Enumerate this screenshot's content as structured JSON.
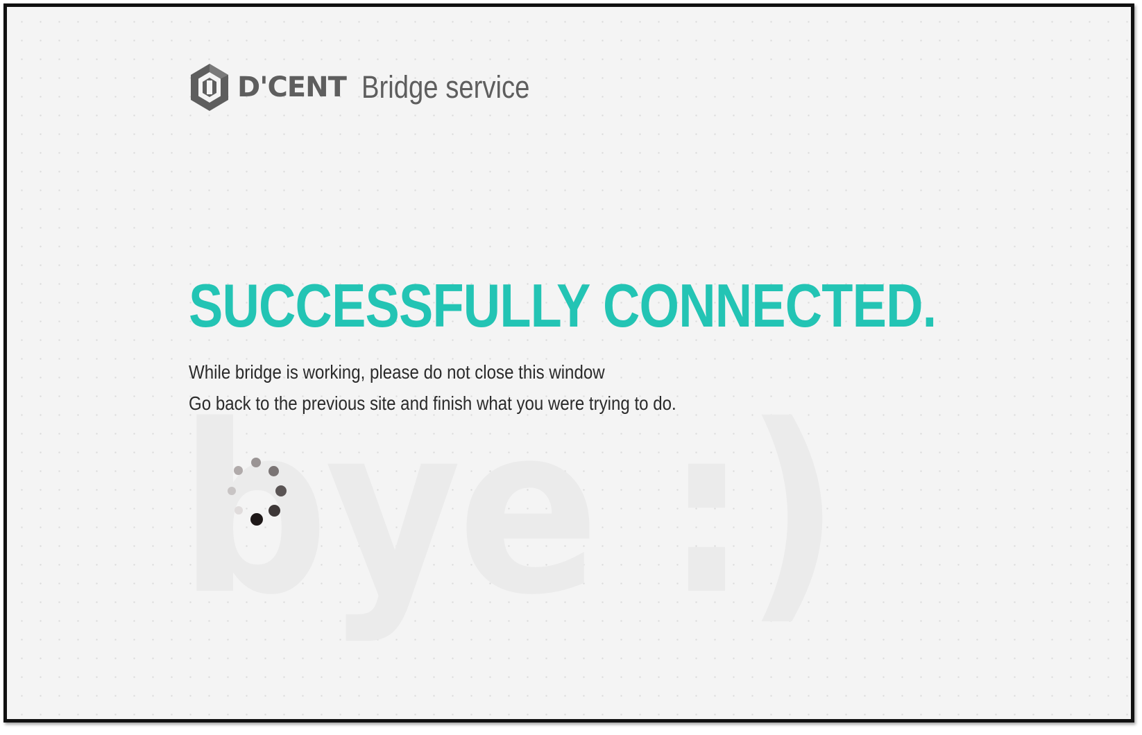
{
  "header": {
    "logo_text": "D'CENT",
    "service_title": "Bridge service"
  },
  "main": {
    "headline": "SUCCESSFULLY CONNECTED.",
    "message_line_1": "While bridge is working, please do not close this window",
    "message_line_2": "Go back to the previous site and finish what you were trying to do.",
    "watermark_text": "bye :)"
  },
  "colors": {
    "accent": "#23c4b4",
    "logo_gray": "#5e5e5e",
    "text": "#2a2a2a",
    "background": "#f4f4f4",
    "watermark": "#ebebeb"
  },
  "icons": {
    "logo": "dcent-hexagon-logo-icon",
    "spinner": "loading-spinner-icon"
  }
}
